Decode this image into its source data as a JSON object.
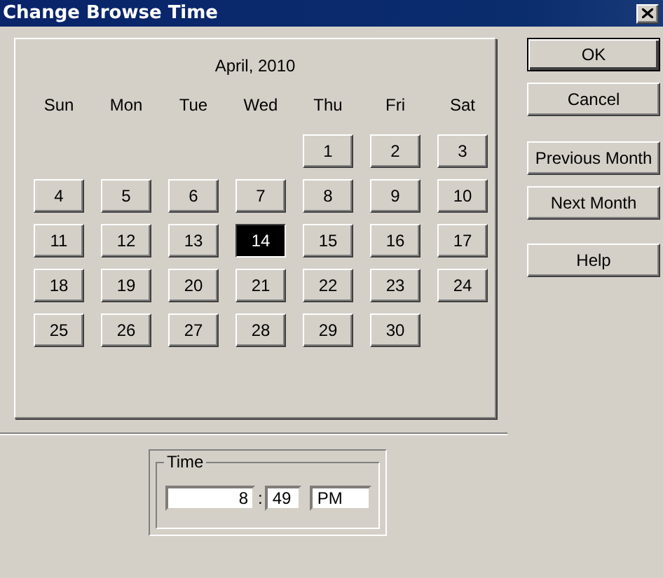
{
  "window": {
    "title": "Change Browse Time"
  },
  "calendar": {
    "month_label": "April, 2010",
    "weekdays": [
      "Sun",
      "Mon",
      "Tue",
      "Wed",
      "Thu",
      "Fri",
      "Sat"
    ],
    "weeks": [
      {
        "kind": "leading",
        "days": [
          {
            "label": "1",
            "selected": false
          },
          {
            "label": "2",
            "selected": false
          },
          {
            "label": "3",
            "selected": false
          }
        ]
      },
      {
        "kind": "full",
        "days": [
          {
            "label": "4",
            "selected": false
          },
          {
            "label": "5",
            "selected": false
          },
          {
            "label": "6",
            "selected": false
          },
          {
            "label": "7",
            "selected": false
          },
          {
            "label": "8",
            "selected": false
          },
          {
            "label": "9",
            "selected": false
          },
          {
            "label": "10",
            "selected": false
          }
        ]
      },
      {
        "kind": "full",
        "days": [
          {
            "label": "11",
            "selected": false
          },
          {
            "label": "12",
            "selected": false
          },
          {
            "label": "13",
            "selected": false
          },
          {
            "label": "14",
            "selected": true
          },
          {
            "label": "15",
            "selected": false
          },
          {
            "label": "16",
            "selected": false
          },
          {
            "label": "17",
            "selected": false
          }
        ]
      },
      {
        "kind": "full",
        "days": [
          {
            "label": "18",
            "selected": false
          },
          {
            "label": "19",
            "selected": false
          },
          {
            "label": "20",
            "selected": false
          },
          {
            "label": "21",
            "selected": false
          },
          {
            "label": "22",
            "selected": false
          },
          {
            "label": "23",
            "selected": false
          },
          {
            "label": "24",
            "selected": false
          }
        ]
      },
      {
        "kind": "trailing",
        "days": [
          {
            "label": "25",
            "selected": false
          },
          {
            "label": "26",
            "selected": false
          },
          {
            "label": "27",
            "selected": false
          },
          {
            "label": "28",
            "selected": false
          },
          {
            "label": "29",
            "selected": false
          },
          {
            "label": "30",
            "selected": false
          }
        ]
      }
    ]
  },
  "time": {
    "label": "Time",
    "hour": "8",
    "separator": ":",
    "minute": "49",
    "period": "PM"
  },
  "buttons": [
    "OK",
    "Cancel",
    "Previous Month",
    "Next Month",
    "Help"
  ]
}
